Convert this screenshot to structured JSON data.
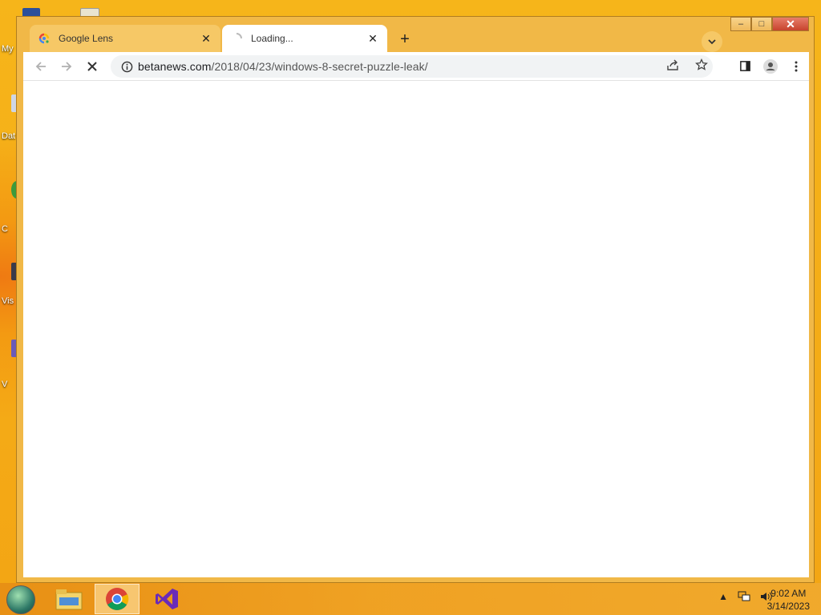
{
  "desktop": {
    "icon_labels": [
      "My",
      "Dat",
      "C",
      "Vis",
      "V"
    ]
  },
  "window": {
    "caption": {
      "minimize": "–",
      "maximize": "□",
      "close": "✕"
    }
  },
  "tabs": [
    {
      "title": "Google Lens",
      "favicon": "google-lens-icon",
      "active": false
    },
    {
      "title": "Loading...",
      "favicon": "loading-spinner-icon",
      "active": true
    }
  ],
  "toolbar": {
    "url_host": "betanews.com",
    "url_path": "/2018/04/23/windows-8-secret-puzzle-leak/"
  },
  "taskbar": {
    "apps": [
      "file-explorer",
      "google-chrome",
      "visual-studio"
    ],
    "time": "9:02 AM",
    "date": "3/14/2023"
  },
  "colors": {
    "desktop_bg": "#f3a514",
    "window_frame": "#f1b847",
    "inactive_tab": "#f6c866"
  }
}
